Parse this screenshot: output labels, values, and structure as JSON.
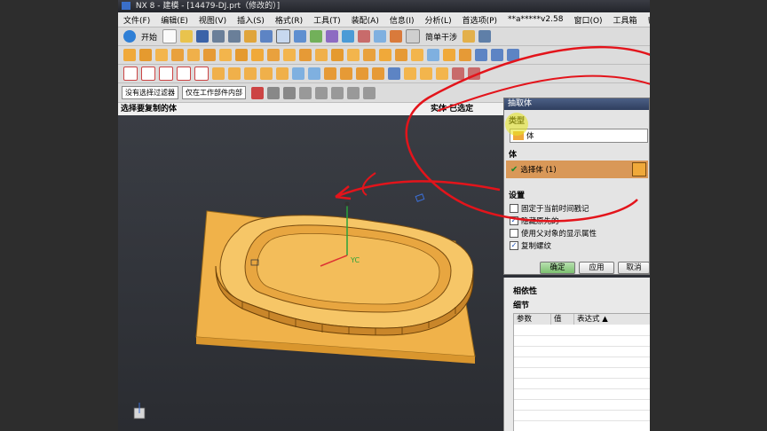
{
  "window": {
    "title": "NX 8 - 建模 - [14479-DJ.prt（修改的）]"
  },
  "menu": {
    "items": [
      {
        "label": "文件(F)"
      },
      {
        "label": "编辑(E)"
      },
      {
        "label": "视图(V)"
      },
      {
        "label": "插入(S)"
      },
      {
        "label": "格式(R)"
      },
      {
        "label": "工具(T)"
      },
      {
        "label": "装配(A)"
      },
      {
        "label": "信息(I)"
      },
      {
        "label": "分析(L)"
      },
      {
        "label": "首选项(P)"
      },
      {
        "label": "**a*****v2.58"
      },
      {
        "label": "窗口(O)"
      },
      {
        "label": "工具箱"
      },
      {
        "label": "帮助(H)"
      }
    ]
  },
  "toolbar": {
    "start_label": "开始",
    "step_label": "简单干涉"
  },
  "filters": {
    "type_filter": "没有选择过滤器",
    "scope_filter": "仅在工作部件内部"
  },
  "cue_line": {
    "prompt": "选择要复制的体",
    "status": "实体 已选定"
  },
  "extract_dialog": {
    "title": "抽取体",
    "section_type": "类型",
    "type_value": "体",
    "section_body": "体",
    "select_body": "选择体 (1)",
    "section_settings": "设置",
    "options": [
      {
        "label": "固定于当前时间戳记",
        "checked": false
      },
      {
        "label": "隐藏原先的",
        "checked": true
      },
      {
        "label": "使用父对象的显示属性",
        "checked": false
      },
      {
        "label": "复制螺纹",
        "checked": true
      }
    ],
    "ok": "确定",
    "apply": "应用",
    "cancel": "取消"
  },
  "part_navigator": {
    "dependencies": "相依性",
    "details": "细节",
    "columns": [
      "参数",
      "值",
      "表达式"
    ]
  },
  "viewport": {
    "axis_label": "YC"
  },
  "colors": {
    "part_face": "#f0b24a",
    "part_top": "#f6c667",
    "annotation": "#e3141b",
    "selected_body_row": "#d99858",
    "highlight": "#e6e62a"
  }
}
